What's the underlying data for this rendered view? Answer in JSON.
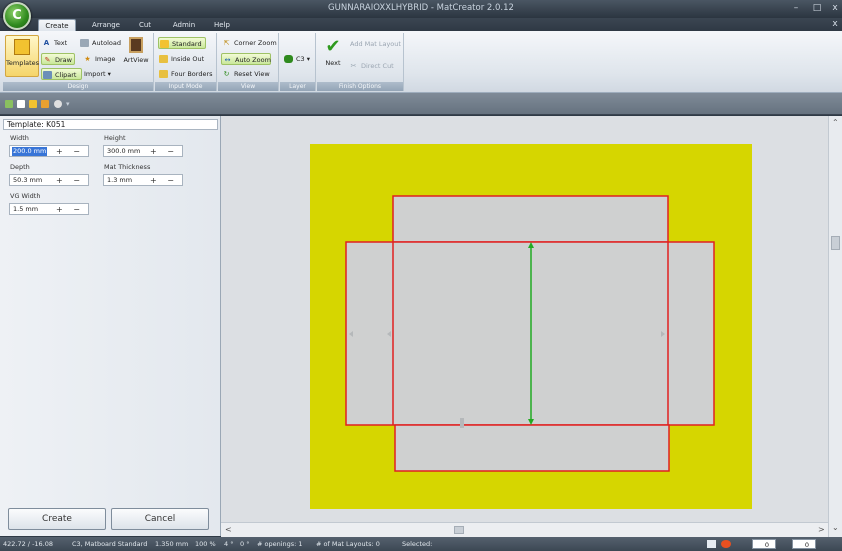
{
  "window": {
    "title": "GUNNARAIOXXLHYBRID - MatCreator 2.0.12",
    "min": "–",
    "max": "□",
    "close": "x",
    "ribbon_close": "x",
    "orb_glyph": "C"
  },
  "tabs": [
    {
      "label": "Create",
      "active": true
    },
    {
      "label": "Arrange",
      "active": false
    },
    {
      "label": "Cut",
      "active": false
    },
    {
      "label": "Admin",
      "active": false
    },
    {
      "label": "Help",
      "active": false
    }
  ],
  "ribbon": {
    "design": {
      "label": "Design",
      "templates": "Templates",
      "text": "Text",
      "autoload": "Autoload",
      "draw": "Draw",
      "image": "Image",
      "artview": "ArtView",
      "clipart": "Clipart",
      "import": "Import ▾"
    },
    "input_mode": {
      "label": "Input Mode",
      "standard": "Standard",
      "inside_out": "Inside Out",
      "four_borders": "Four Borders"
    },
    "view": {
      "label": "View",
      "corner_zoom": "Corner Zoom",
      "auto_zoom": "Auto Zoom",
      "reset_view": "Reset View"
    },
    "layer": {
      "label": "Layer",
      "value": "C3 ▾"
    },
    "finish": {
      "label": "Finish Options",
      "next": "Next",
      "add_mat_layout": "Add Mat Layout",
      "direct_cut": "Direct Cut"
    }
  },
  "panel": {
    "title": "Template: K051",
    "width_label": "Width",
    "width_value": "200.0 mm",
    "height_label": "Height",
    "height_value": "300.0 mm",
    "depth_label": "Depth",
    "depth_value": "50.3 mm",
    "thickness_label": "Mat Thickness",
    "thickness_value": "1.3 mm",
    "vg_label": "VG Width",
    "vg_value": "1.5 mm",
    "plusminus": "+ −",
    "create": "Create",
    "cancel": "Cancel"
  },
  "status": {
    "coords": "422.72 / -16.08",
    "material": "C3, Matboard Standard",
    "thickness": "1.350 mm",
    "zoom": "100 %",
    "angle1": "4 °",
    "angle2": "0 °",
    "openings": "# openings:  1",
    "layouts": "# of Mat Layouts: 0",
    "selected": "Selected:",
    "spin1": "0",
    "spin2": "0"
  },
  "colors": {
    "mat": "#d6d600",
    "cut_line": "#e02020",
    "measure": "#22aa22",
    "panel_fill": "#cfd0d0"
  }
}
